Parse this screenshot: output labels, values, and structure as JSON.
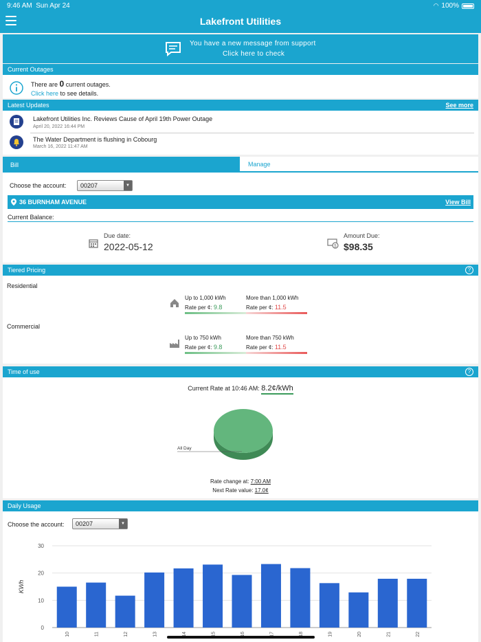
{
  "status_bar": {
    "time": "9:46 AM",
    "date": "Sun Apr 24",
    "battery": "100%"
  },
  "app": {
    "title": "Lakefront Utilities"
  },
  "message_banner": {
    "line1": "You have a new message from support",
    "line2": "Click here to check"
  },
  "outages": {
    "header": "Current Outages",
    "text_before": "There are",
    "count": "0",
    "text_after": "current outages.",
    "link": "Click here",
    "link_suffix": "to see details."
  },
  "updates": {
    "header": "Latest Updates",
    "see_more": "See more",
    "items": [
      {
        "title": "Lakefront Utilities Inc. Reviews Cause of April 19th Power Outage",
        "date": "April 20, 2022 16:44 PM",
        "icon": "news-icon"
      },
      {
        "title": "The Water Department is flushing in Cobourg",
        "date": "March 16, 2022 11:47 AM",
        "icon": "bell-icon"
      }
    ]
  },
  "bill": {
    "tabs": [
      "Bill",
      "Manage"
    ],
    "choose_label": "Choose the account:",
    "account": "00207",
    "address": "36 BURNHAM AVENUE",
    "view_bill": "View Bill",
    "balance_label": "Current Balance:",
    "due_label": "Due date:",
    "due_value": "2022-05-12",
    "amount_label": "Amount Due:",
    "amount_value": "$98.35"
  },
  "tiered": {
    "header": "Tiered Pricing",
    "help": "?",
    "groups": [
      {
        "name": "Residential",
        "tier1": "Up to 1,000 kWh",
        "tier2": "More than 1,000 kWh",
        "rate_label": "Rate per ¢:",
        "rate1": "9.8",
        "rate2": "11.5",
        "icon": "house-icon"
      },
      {
        "name": "Commercial",
        "tier1": "Up to 750 kWh",
        "tier2": "More than 750 kWh",
        "rate_label": "Rate per ¢:",
        "rate1": "9.8",
        "rate2": "11.5",
        "icon": "factory-icon"
      }
    ]
  },
  "time_of_use": {
    "header": "Time of use",
    "help": "?",
    "current_rate_label": "Current Rate at 10:46 AM:",
    "current_rate_value": "8.2¢/kWh",
    "pie_label": "All Day",
    "rate_change_label": "Rate change at:",
    "rate_change_value": "7:00 AM",
    "next_rate_label": "Next Rate value:",
    "next_rate_value": "17.0¢",
    "colors": {
      "pie_top": "#63b67d",
      "pie_side": "#3f8a56"
    }
  },
  "daily_usage": {
    "header": "Daily Usage",
    "choose_label": "Choose the account:",
    "account": "00207"
  },
  "chart_data": {
    "type": "bar",
    "ylabel": "KWh",
    "ylim": [
      0,
      30
    ],
    "yticks": [
      0,
      10,
      20,
      30
    ],
    "categories": [
      "10",
      "11",
      "12",
      "13",
      "14",
      "15",
      "16",
      "17",
      "18",
      "19",
      "20",
      "21",
      "22"
    ],
    "values": [
      15,
      16.5,
      11.7,
      20.2,
      21.7,
      23.1,
      19.3,
      23.3,
      21.8,
      16.3,
      12.9,
      17.9,
      17.9
    ],
    "bar_color": "#2a66d0",
    "grid": true
  },
  "colors": {
    "accent": "#1ba5cf",
    "green": "#3a9a5a",
    "red": "#e04848"
  }
}
